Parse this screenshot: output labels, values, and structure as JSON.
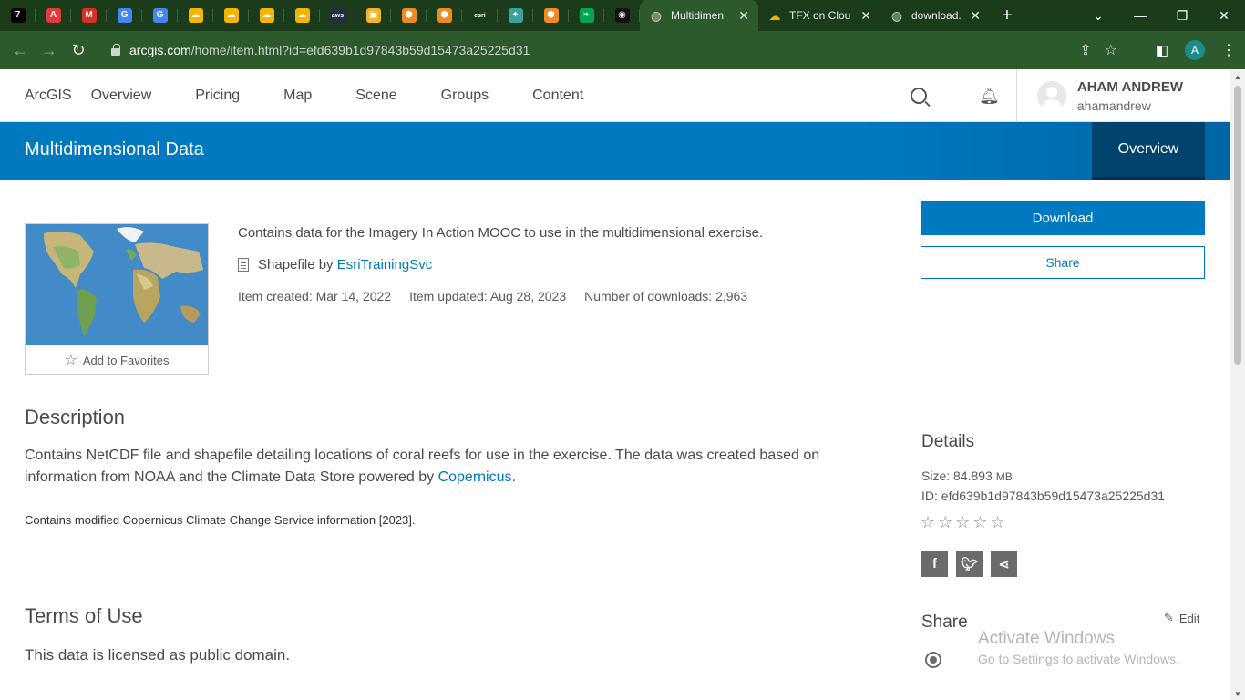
{
  "browser": {
    "pinned_tabs": [
      {
        "icon": "seven-icon",
        "glyph": "7",
        "color": "#000000"
      },
      {
        "icon": "acrobat-icon",
        "glyph": "A",
        "color": "#e23b3b"
      },
      {
        "icon": "gmail-icon",
        "glyph": "M",
        "color": "#d93025"
      },
      {
        "icon": "google-icon",
        "glyph": "G",
        "color": "#4285f4"
      },
      {
        "icon": "google-icon",
        "glyph": "G",
        "color": "#4285f4"
      },
      {
        "icon": "gcloud-icon",
        "glyph": "☁",
        "color": "#f4b400"
      },
      {
        "icon": "gcloud-icon",
        "glyph": "☁",
        "color": "#f4b400"
      },
      {
        "icon": "gcloud-icon",
        "glyph": "☁",
        "color": "#f4b400"
      },
      {
        "icon": "gcloud-icon",
        "glyph": "☁",
        "color": "#f4b400"
      },
      {
        "icon": "aws-icon",
        "glyph": "aws",
        "color": "#232f3e"
      },
      {
        "icon": "box-icon",
        "glyph": "▣",
        "color": "#f0b429"
      },
      {
        "icon": "cube-icon",
        "glyph": "⬢",
        "color": "#f08a24"
      },
      {
        "icon": "cube-icon",
        "glyph": "⬢",
        "color": "#f08a24"
      },
      {
        "icon": "esri-icon",
        "glyph": "esri",
        "color": "#1b3c1b"
      },
      {
        "icon": "notebook-icon",
        "glyph": "✦",
        "color": "#3aa0a0"
      },
      {
        "icon": "cube-icon",
        "glyph": "⬢",
        "color": "#f08a24"
      },
      {
        "icon": "leaf-icon",
        "glyph": "❧",
        "color": "#00a651"
      },
      {
        "icon": "app-icon",
        "glyph": "◉",
        "color": "#111111"
      }
    ],
    "tabs": [
      {
        "title": "Multidimen",
        "active": true
      },
      {
        "title": "TFX on Clou",
        "active": false
      },
      {
        "title": "download.p",
        "active": false
      }
    ],
    "url_domain": "arcgis.com",
    "url_path": "/home/item.html?id=efd639b1d97843b59d15473a25225d31",
    "profile_initial": "A"
  },
  "nav": {
    "items": [
      "ArcGIS",
      "Overview",
      "Pricing",
      "Map",
      "Scene",
      "Groups",
      "Content"
    ],
    "user_name": "AHAM ANDREW",
    "user_id": "ahamandrew"
  },
  "banner": {
    "title": "Multidimensional Data",
    "tab": "Overview"
  },
  "item": {
    "add_favorites": "Add to Favorites",
    "summary": "Contains data for the Imagery In Action MOOC to use in the multidimensional exercise.",
    "type_prefix": "Shapefile by",
    "owner": "EsriTrainingSvc",
    "created": "Item created: Mar 14, 2022",
    "updated": "Item updated: Aug 28, 2023",
    "downloads": "Number of downloads: 2,963",
    "download_label": "Download",
    "share_label": "Share"
  },
  "description": {
    "heading": "Description",
    "text": "Contains NetCDF file and shapefile detailing locations of coral reefs for use in the exercise. The data was created based on information from NOAA and the Climate Data Store powered by",
    "link": "Copernicus",
    "after_link": ".",
    "small": "Contains modified Copernicus Climate Change Service information [2023]."
  },
  "terms": {
    "heading": "Terms of Use",
    "text": "This data is licensed as public domain."
  },
  "details": {
    "heading": "Details",
    "size_label": "Size:",
    "size_value": "84.893",
    "size_unit": "MB",
    "id_label": "ID:",
    "id_value": "efd639b1d97843b59d15473a25225d31",
    "rating": 0,
    "rating_max": 5,
    "share_heading": "Share",
    "edit_label": "Edit"
  },
  "watermark": {
    "line1": "Activate Windows",
    "line2": "Go to Settings to activate Windows."
  },
  "colors": {
    "brand": "#0079c1",
    "banner_tab": "#00446e",
    "browser_frame": "#1b3c1b"
  }
}
